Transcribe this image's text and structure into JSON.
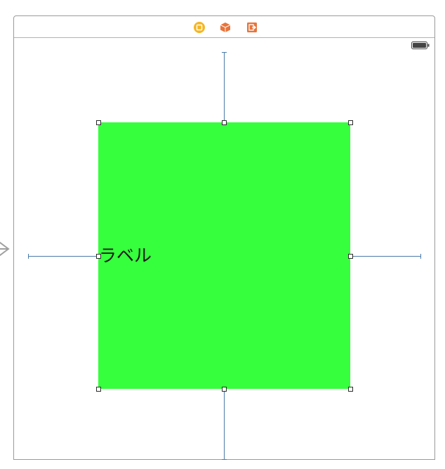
{
  "canvas": {
    "view": {
      "background_color": "#36ff3d",
      "label_text": "ラベル"
    },
    "dock_icons": [
      "view-controller-icon",
      "first-responder-icon",
      "exit-icon"
    ],
    "status_bar": {
      "battery_icon": "battery-icon"
    },
    "entry_point_icon": "storyboard-entry-arrow-icon",
    "colors": {
      "constraint": "#4a7aa8",
      "view_controller_icon": "#f5b623",
      "first_responder_icon": "#e8743b",
      "exit_icon": "#e8743b"
    }
  }
}
